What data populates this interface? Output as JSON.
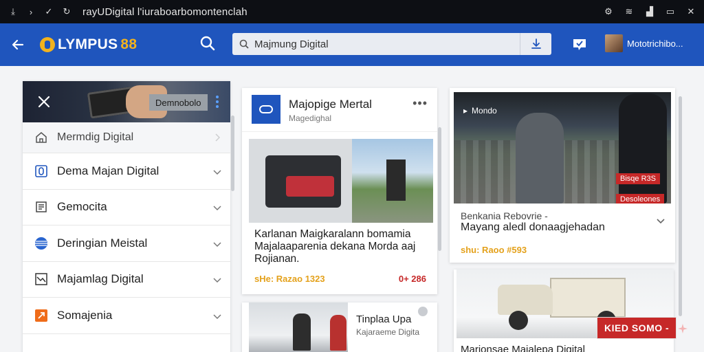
{
  "statusbar": {
    "url": "rayUDigital l'iuraboarbomontenclah"
  },
  "header": {
    "logo": "OLYMPUS88",
    "logo_main": "LYMPUS",
    "logo_accent": "88",
    "search_value": "Majmung Digital",
    "user_name": "Mototrichibo...",
    "colors": {
      "bar": "#1f55bd",
      "accent": "#f2b21e"
    }
  },
  "sidemenu": {
    "tag": "Demnobolo",
    "items": [
      {
        "label": "Mermdig Digital",
        "icon": "home-icon"
      },
      {
        "label": "Dema Majan Digital",
        "icon": "phone-icon"
      },
      {
        "label": "Gemocita",
        "icon": "document-icon"
      },
      {
        "label": "Deringian Meistal",
        "icon": "globe-icon"
      },
      {
        "label": "Majamlag Digital",
        "icon": "chart-icon"
      },
      {
        "label": "Somajenia",
        "icon": "share-icon"
      }
    ]
  },
  "feed": {
    "card1": {
      "title": "Majopige Mertal",
      "subtitle": "Magedighal",
      "body": "Karlanan Maigkaralann bomamia Majalaaparenia dekana Morda aaj Rojianan.",
      "meta": "sHe: Razao 1323",
      "count": "0+ 286"
    },
    "card2": {
      "title": "Tinplaa Upa",
      "subtitle": "Kajaraeme Digita"
    },
    "card3": {
      "tag": "Mondo",
      "badge1": "Bisqe R3S",
      "badge2": "Desoleones",
      "line1": "Benkania Rebovrie -",
      "line2": "Mayang aledl donaagjehadan",
      "meta": "shu: Raoo #593"
    },
    "card4": {
      "title": "Marjonsae Majalepa Digital"
    }
  },
  "promo": {
    "label": "KIED SOMO -"
  }
}
